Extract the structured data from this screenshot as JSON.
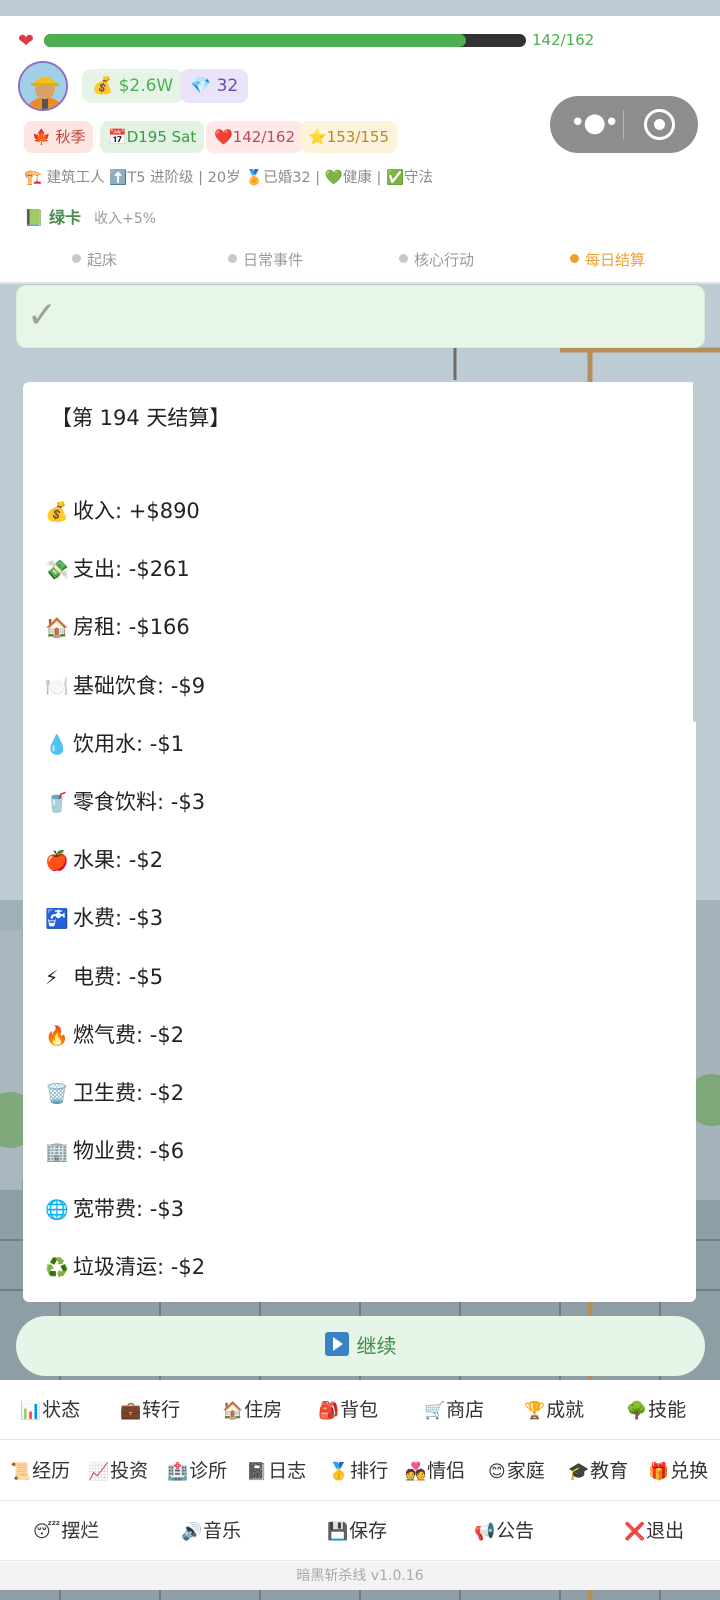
{
  "status": {
    "hp_current": 142,
    "hp_max": 162,
    "hp_text": "142/162",
    "money": "$2.6W",
    "gems": "32"
  },
  "tags": {
    "season": "秋季",
    "day": "D195 Sat",
    "hp": "142/162",
    "star": "153/155"
  },
  "profile_line": "建筑工人 ⬆️T5 进阶级 | 20岁 🏅已婚32 | 💚健康 | ✅守法",
  "card": {
    "name": "绿卡",
    "bonus": "收入+5%"
  },
  "steps": [
    {
      "label": "起床",
      "active": false
    },
    {
      "label": "日常事件",
      "active": false
    },
    {
      "label": "核心行动",
      "active": false
    },
    {
      "label": "每日结算",
      "active": true
    }
  ],
  "check_mark": "✓",
  "settlement": {
    "title": "【第 194 天结算】",
    "items": [
      {
        "icon": "💰",
        "text": "收入: +$890"
      },
      {
        "icon": "💸",
        "text": "支出: -$261"
      },
      {
        "icon": "🏠",
        "text": "房租: -$166"
      },
      {
        "icon": "🍽️",
        "text": "基础饮食: -$9"
      },
      {
        "icon": "💧",
        "text": "饮用水: -$1"
      },
      {
        "icon": "🥤",
        "text": "零食饮料: -$3"
      },
      {
        "icon": "🍎",
        "text": "水果: -$2"
      },
      {
        "icon": "🚰",
        "text": "水费: -$3"
      },
      {
        "icon": "⚡",
        "text": "电费: -$5"
      },
      {
        "icon": "🔥",
        "text": "燃气费: -$2"
      },
      {
        "icon": "🗑️",
        "text": "卫生费: -$2"
      },
      {
        "icon": "🏢",
        "text": "物业费: -$6"
      },
      {
        "icon": "🌐",
        "text": "宽带费: -$3"
      },
      {
        "icon": "♻️",
        "text": "垃圾清运: -$2"
      }
    ]
  },
  "continue_label": "继续",
  "nav": {
    "row1": [
      {
        "icon": "📊",
        "label": "状态"
      },
      {
        "icon": "💼",
        "label": "转行"
      },
      {
        "icon": "🏠",
        "label": "住房"
      },
      {
        "icon": "🎒",
        "label": "背包"
      },
      {
        "icon": "🛒",
        "label": "商店"
      },
      {
        "icon": "🏆",
        "label": "成就"
      },
      {
        "icon": "🌳",
        "label": "技能"
      }
    ],
    "row2": [
      {
        "icon": "📜",
        "label": "经历"
      },
      {
        "icon": "📈",
        "label": "投资"
      },
      {
        "icon": "🏥",
        "label": "诊所"
      },
      {
        "icon": "📓",
        "label": "日志"
      },
      {
        "icon": "🥇",
        "label": "排行"
      },
      {
        "icon": "💑",
        "label": "情侣"
      },
      {
        "icon": "😊",
        "label": "家庭"
      },
      {
        "icon": "🎓",
        "label": "教育"
      },
      {
        "icon": "🎁",
        "label": "兑换"
      }
    ],
    "row3": [
      {
        "icon": "😴",
        "label": "摆烂"
      },
      {
        "icon": "🔊",
        "label": "音乐"
      },
      {
        "icon": "💾",
        "label": "保存"
      },
      {
        "icon": "📢",
        "label": "公告"
      },
      {
        "icon": "❌",
        "label": "退出"
      }
    ]
  },
  "version": "暗黑斩杀线 v1.0.16",
  "colors": {
    "hp_green": "#4caf50",
    "active_step": "#f0a030",
    "panel_bg": "#ffffff",
    "banner_bg": "#e8f6e9"
  },
  "icons": {
    "heart": "heart-icon",
    "money": "money-bag-icon",
    "gem": "gem-icon",
    "season": "maple-leaf-icon",
    "calendar": "calendar-icon",
    "star": "star-icon",
    "crane": "crane-icon",
    "card": "green-book-icon",
    "play": "play-icon",
    "more": "more-dots-icon",
    "target": "target-icon"
  }
}
